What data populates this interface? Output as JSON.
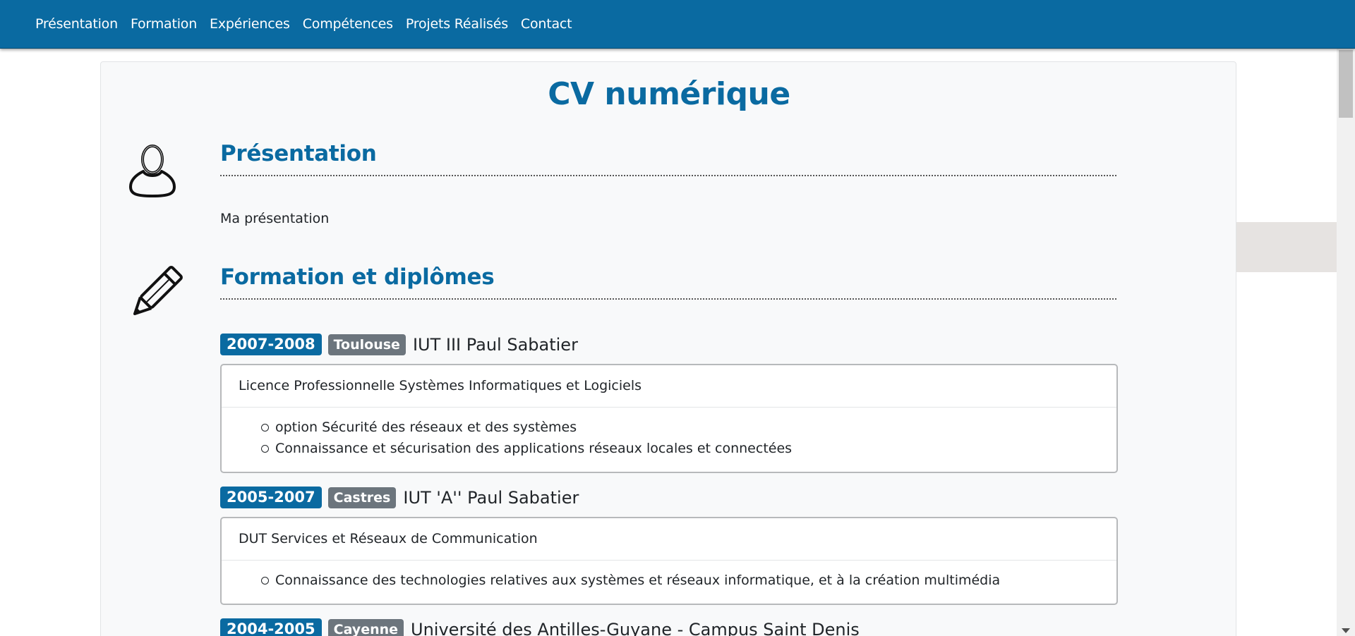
{
  "nav": {
    "items": [
      "Présentation",
      "Formation",
      "Expériences",
      "Compétences",
      "Projets Réalisés",
      "Contact"
    ]
  },
  "page": {
    "title": "CV numérique"
  },
  "presentation": {
    "icon": "user-icon",
    "heading": "Présentation",
    "text": "Ma présentation"
  },
  "formation": {
    "icon": "pencil-icon",
    "heading": "Formation et diplômes",
    "entries": [
      {
        "years": "2007-2008",
        "city": "Toulouse",
        "school": "IUT III Paul Sabatier",
        "degree": "Licence Professionnelle Systèmes Informatiques et Logiciels",
        "details": [
          "option Sécurité des réseaux et des systèmes",
          "Connaissance et sécurisation des applications réseaux locales et connectées"
        ]
      },
      {
        "years": "2005-2007",
        "city": "Castres",
        "school": "IUT 'A'' Paul Sabatier",
        "degree": "DUT Services et Réseaux de Communication",
        "details": [
          "Connaissance des technologies relatives aux systèmes et réseaux informatique, et à la création multimédia"
        ]
      },
      {
        "years": "2004-2005",
        "city": "Cayenne",
        "school": "Université des Antilles-Guyane - Campus Saint Denis"
      }
    ]
  },
  "colors": {
    "brand": "#0a6aa1",
    "badge_gray": "#6c757d"
  }
}
